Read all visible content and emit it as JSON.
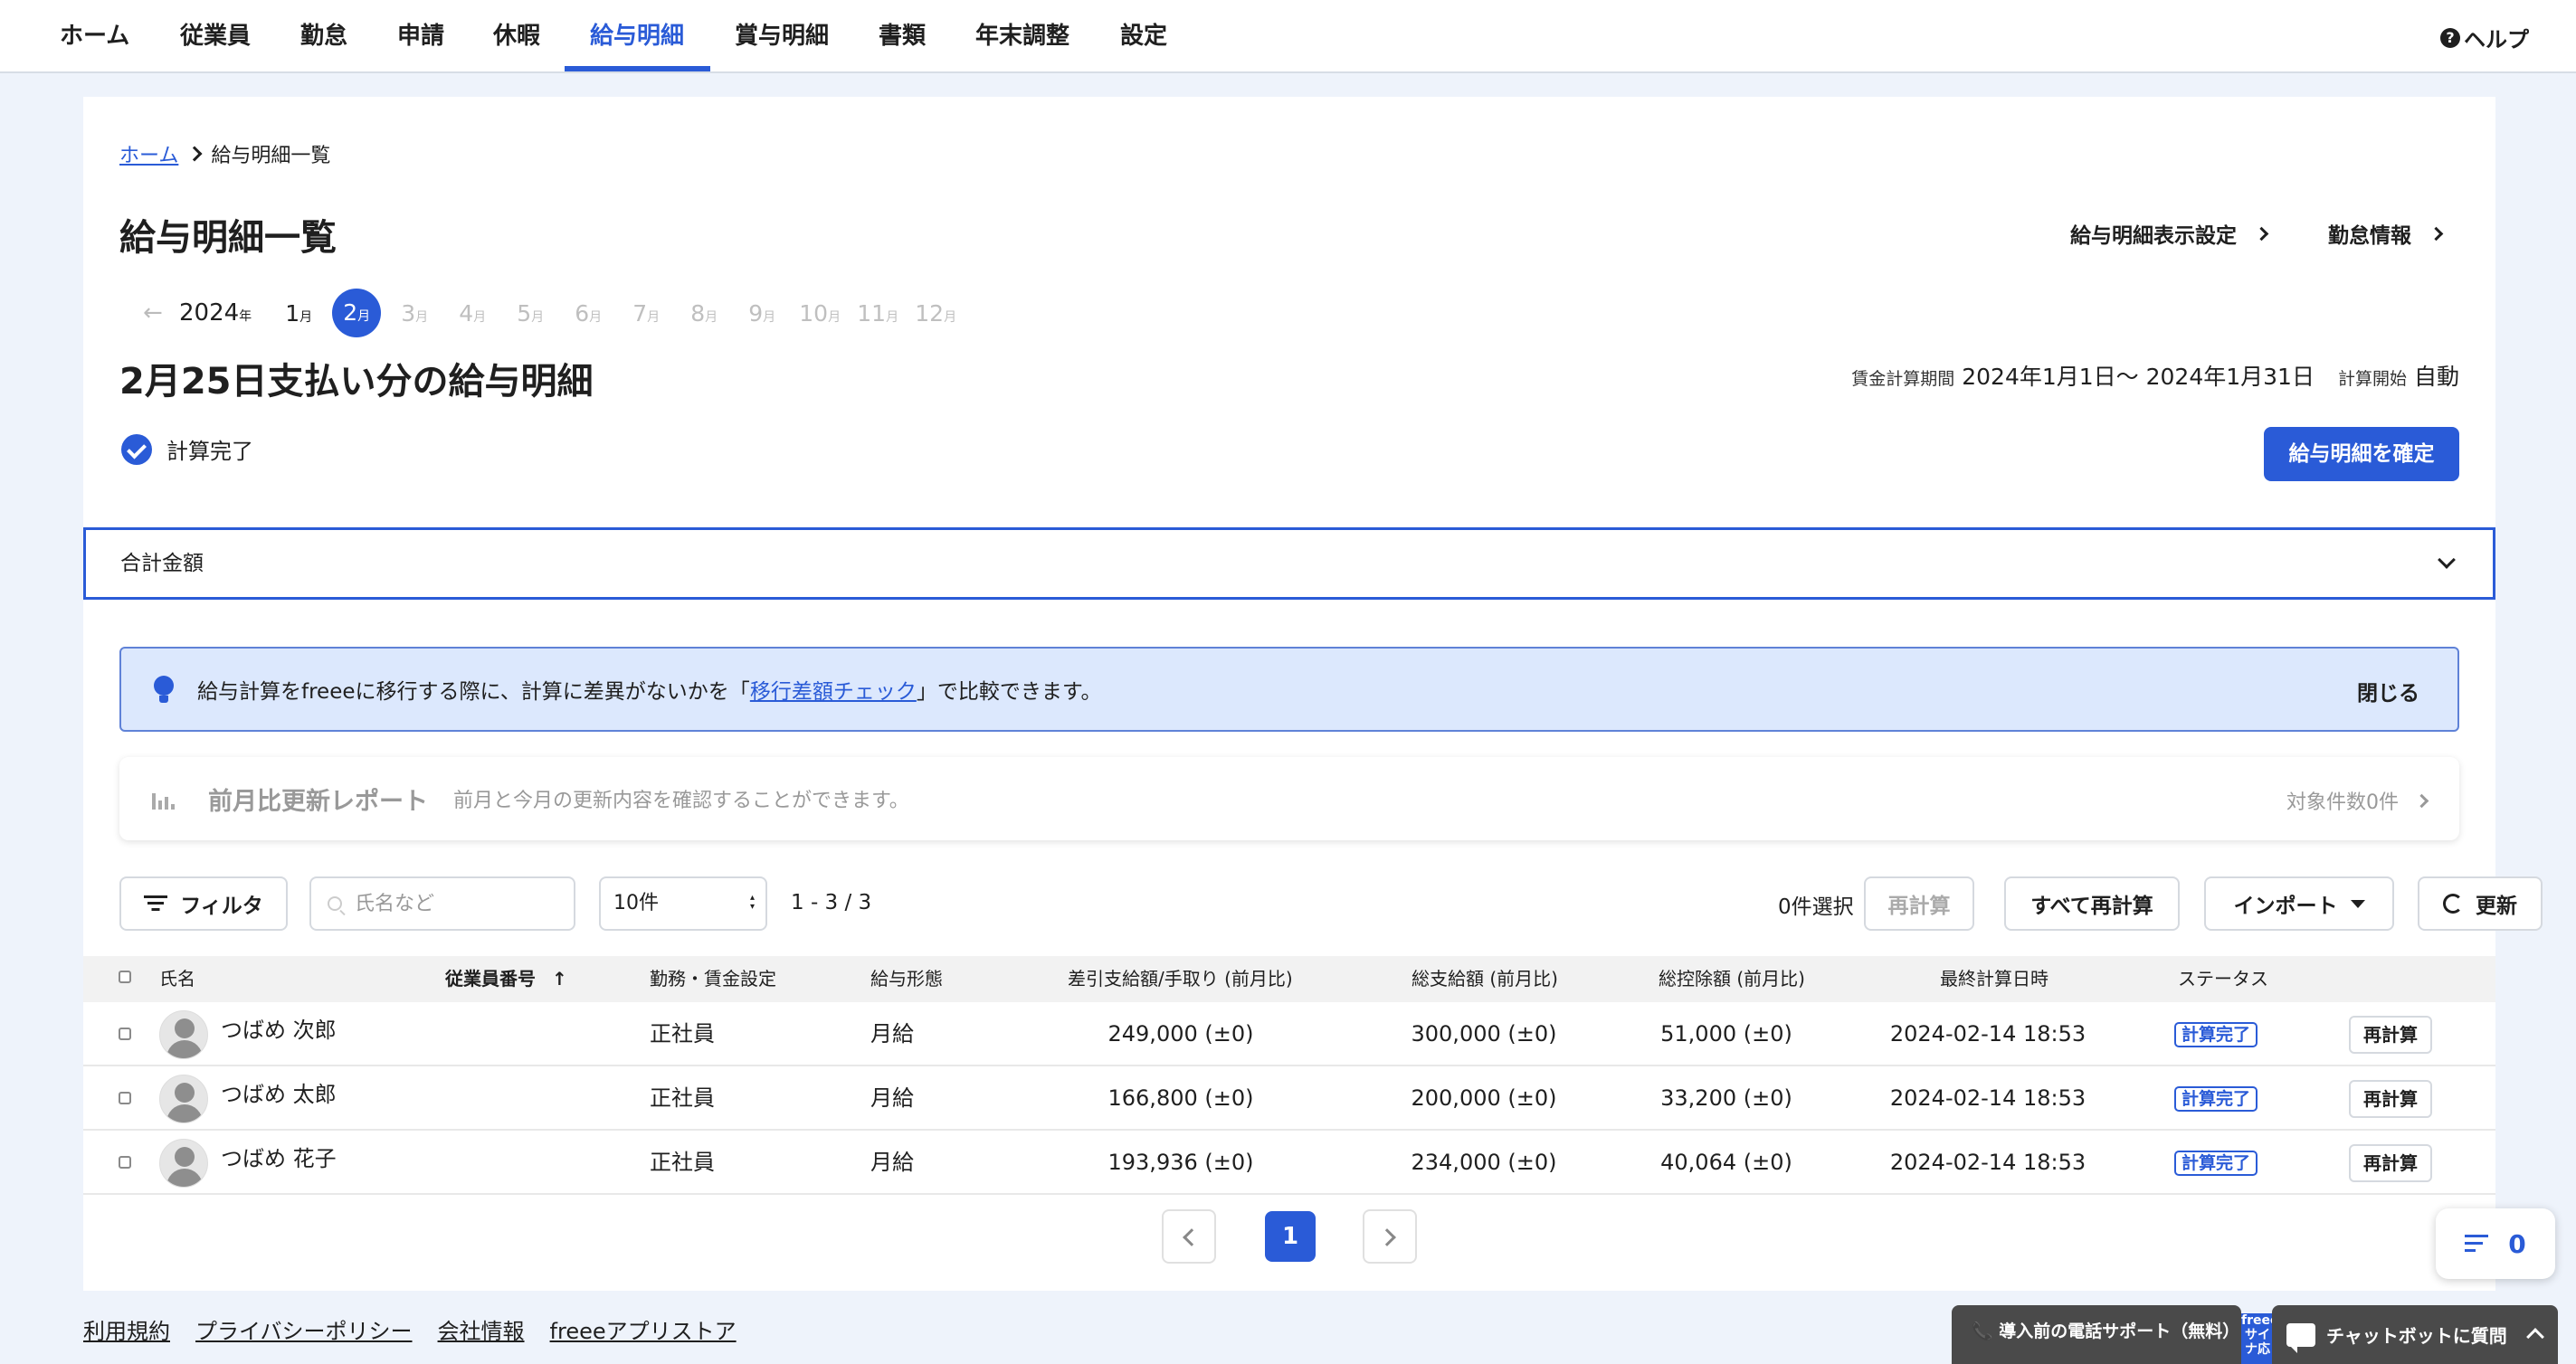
{
  "nav": {
    "items": [
      "ホーム",
      "従業員",
      "勤怠",
      "申請",
      "休暇",
      "給与明細",
      "賞与明細",
      "書類",
      "年末調整",
      "設定"
    ],
    "active": "給与明細",
    "help_label": "ヘルプ"
  },
  "breadcrumb": {
    "home": "ホーム",
    "current": "給与明細一覧"
  },
  "page_title": "給与明細一覧",
  "header_links": {
    "display_settings": "給与明細表示設定",
    "attendance_info": "勤怠情報"
  },
  "month_picker": {
    "year": "2024",
    "year_unit": "年",
    "month_unit": "月",
    "months": [
      "1",
      "2",
      "3",
      "4",
      "5",
      "6",
      "7",
      "8",
      "9",
      "10",
      "11",
      "12"
    ],
    "selected": "2",
    "enabled": [
      "1",
      "2"
    ]
  },
  "payslip": {
    "title": "2月25日支払い分の給与明細",
    "period_label": "賃金計算期間",
    "period_value": "2024年1月1日〜 2024年1月31日",
    "calc_start_label": "計算開始",
    "calc_start_value": "自動",
    "status_text": "計算完了",
    "confirm_button": "給与明細を確定"
  },
  "total_section": {
    "label": "合計金額"
  },
  "info_banner": {
    "text_before": "給与計算をfreeeに移行する際に、計算に差異がないかを「",
    "link_text": "移行差額チェック",
    "text_after": "」で比較できます。",
    "close_label": "閉じる"
  },
  "report": {
    "title": "前月比更新レポート",
    "description": "前月と今月の更新内容を確認することができます。",
    "count_text": "対象件数0件"
  },
  "toolbar": {
    "filter_label": "フィルタ",
    "search_placeholder": "氏名など",
    "per_page": "10件",
    "range_text": "1 - 3 / 3",
    "selected_count": "0件選択",
    "recalc_label": "再計算",
    "recalc_all_label": "すべて再計算",
    "import_label": "インポート",
    "refresh_label": "更新"
  },
  "table": {
    "headers": [
      "氏名",
      "従業員番号",
      "勤務・賃金設定",
      "給与形態",
      "差引支給額/手取り (前月比)",
      "総支給額 (前月比)",
      "総控除額 (前月比)",
      "最終計算日時",
      "ステータス"
    ],
    "rows": [
      {
        "name": "つばめ 次郎",
        "employee_no": "",
        "work_setting": "正社員",
        "pay_type": "月給",
        "net_pay": "249,000 (±0)",
        "gross_pay": "300,000 (±0)",
        "deductions": "51,000 (±0)",
        "last_calc": "2024-02-14 18:53",
        "status": "計算完了",
        "action": "再計算"
      },
      {
        "name": "つばめ 太郎",
        "employee_no": "",
        "work_setting": "正社員",
        "pay_type": "月給",
        "net_pay": "166,800 (±0)",
        "gross_pay": "200,000 (±0)",
        "deductions": "33,200 (±0)",
        "last_calc": "2024-02-14 18:53",
        "status": "計算完了",
        "action": "再計算"
      },
      {
        "name": "つばめ 花子",
        "employee_no": "",
        "work_setting": "正社員",
        "pay_type": "月給",
        "net_pay": "193,936 (±0)",
        "gross_pay": "234,000 (±0)",
        "deductions": "40,064 (±0)",
        "last_calc": "2024-02-14 18:53",
        "status": "計算完了",
        "action": "再計算"
      }
    ]
  },
  "pagination": {
    "current": "1"
  },
  "footer": {
    "links": [
      "利用規約",
      "プライバシーポリシー",
      "会社情報",
      "freeeアプリストア"
    ]
  },
  "floating": {
    "todo_count": "0",
    "phone_support": "導入前の電話サポート（無料）",
    "freee_tab": "freeeサイナ応",
    "chatbot": "チャットボットに質問"
  },
  "colors": {
    "accent": "#2a5bd7",
    "background": "#eef3fb",
    "banner_bg": "#dce8fd"
  }
}
